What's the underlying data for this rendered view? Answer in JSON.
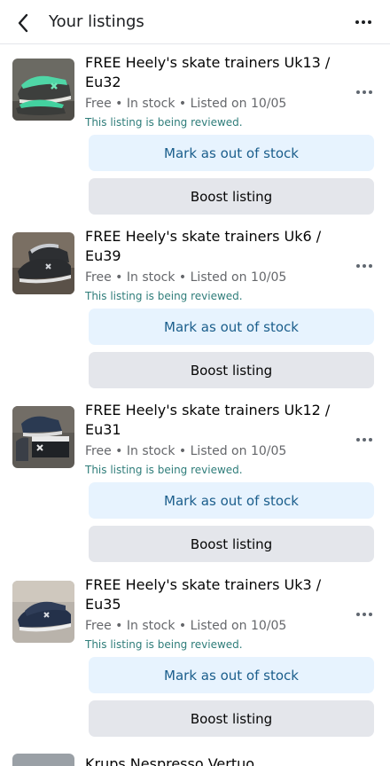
{
  "header": {
    "title": "Your listings"
  },
  "listings": [
    {
      "title": "FREE Heely's skate trainers Uk13 / Eu32",
      "meta": "Free • In stock • Listed on 10/05",
      "review": "This listing is being reviewed.",
      "out_of_stock_label": "Mark as out of stock",
      "boost_label": "Boost listing"
    },
    {
      "title": "FREE Heely's skate trainers Uk6 / Eu39",
      "meta": "Free • In stock • Listed on 10/05",
      "review": "This listing is being reviewed.",
      "out_of_stock_label": "Mark as out of stock",
      "boost_label": "Boost listing"
    },
    {
      "title": "FREE Heely's skate trainers Uk12 / Eu31",
      "meta": "Free • In stock • Listed on 10/05",
      "review": "This listing is being reviewed.",
      "out_of_stock_label": "Mark as out of stock",
      "boost_label": "Boost listing"
    },
    {
      "title": "FREE Heely's skate trainers Uk3 / Eu35",
      "meta": "Free • In stock • Listed on 10/05",
      "review": "This listing is being reviewed.",
      "out_of_stock_label": "Mark as out of stock",
      "boost_label": "Boost listing"
    }
  ],
  "partial_listing": {
    "title": "Krups Nespresso Vertuo"
  },
  "colors": {
    "accent_text": "#1b5e8c",
    "accent_bg": "#e7f3fe",
    "review_text": "#2f7d7a",
    "secondary_bg": "#e4e6eb"
  },
  "icons": {
    "back": "chevron-left-icon",
    "more": "more-horizontal-icon"
  }
}
